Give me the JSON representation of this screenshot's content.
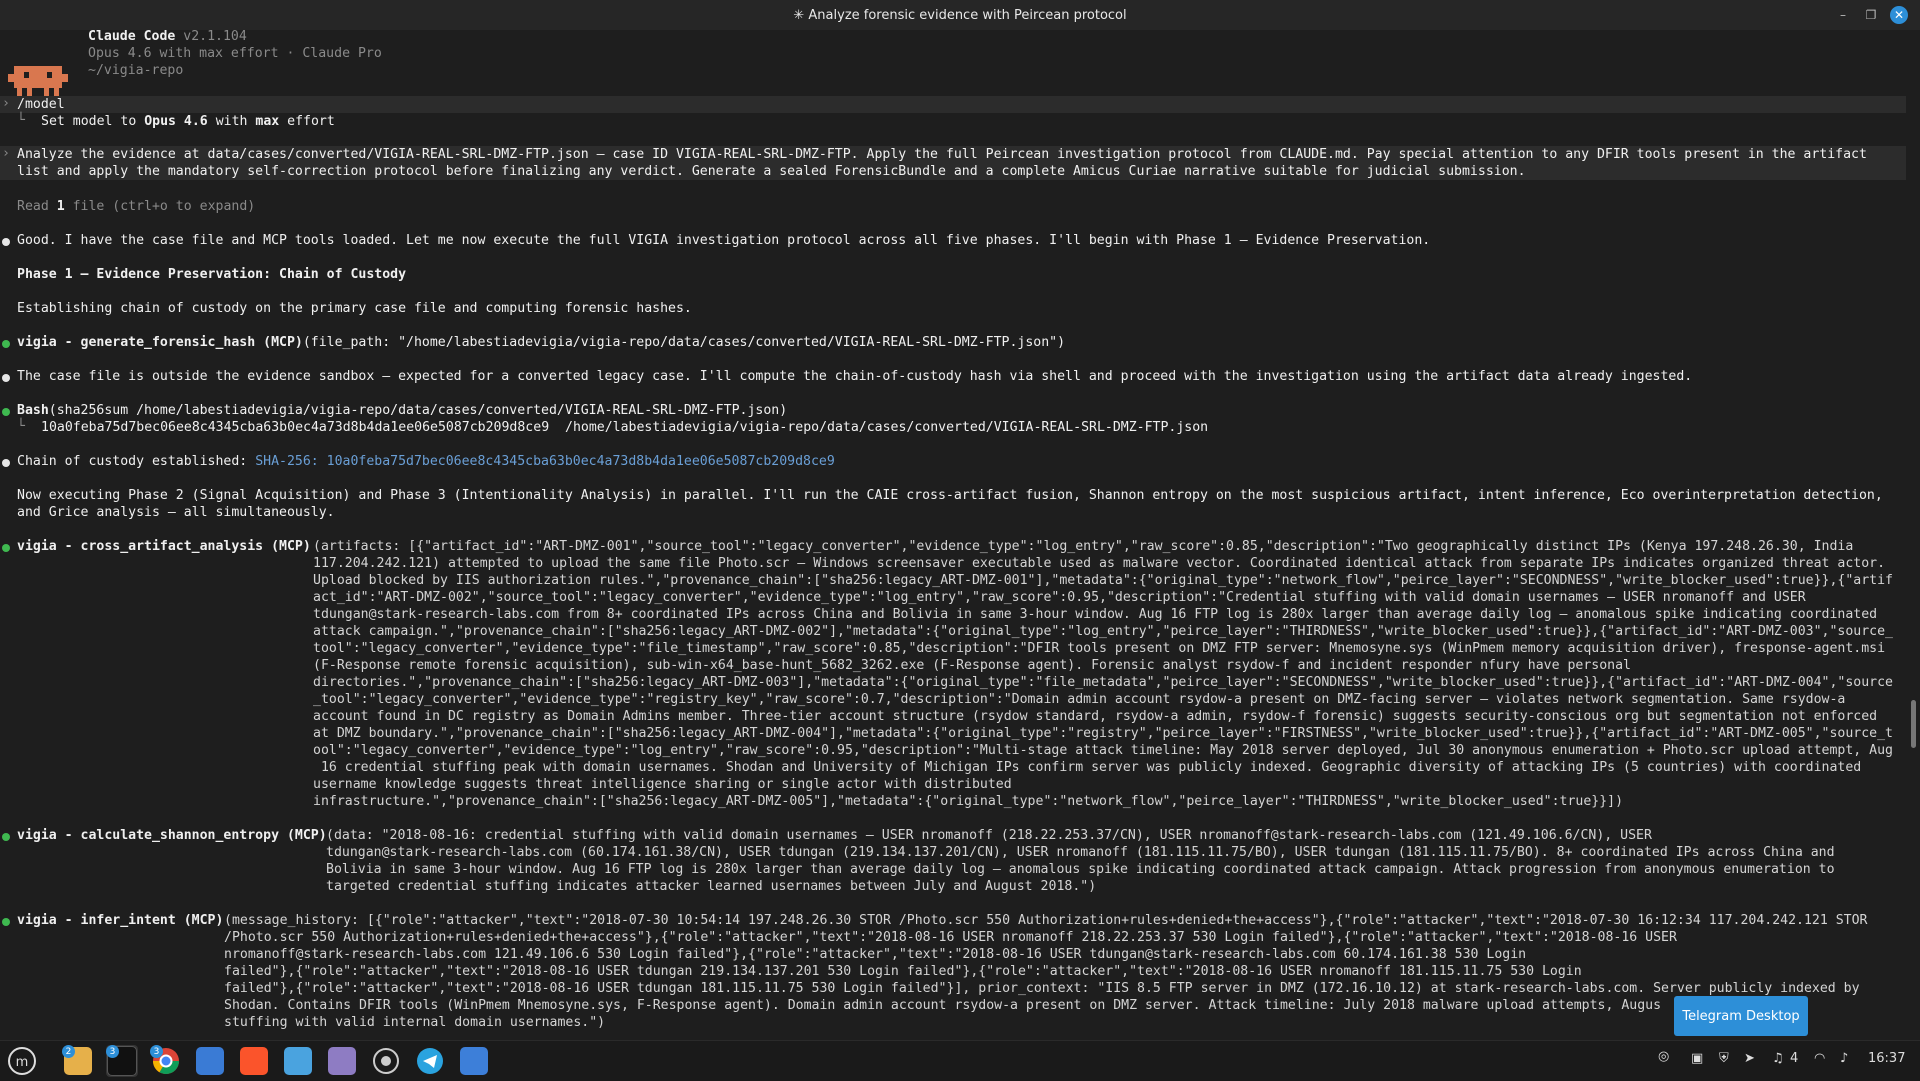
{
  "window": {
    "title": "✳ Analyze forensic evidence with Peircean protocol"
  },
  "header": {
    "app_name": "Claude Code",
    "version": "v2.1.104",
    "model_line": "Opus 4.6 with max effort · Claude Pro",
    "cwd": "~/vigia-repo"
  },
  "model_cmd": {
    "command": "/model",
    "result_prefix": "Set model to ",
    "result_model": "Opus 4.6",
    "result_mid": " with ",
    "result_effort": "max",
    "result_suffix": " effort"
  },
  "user_prompt": {
    "line1": "Analyze the evidence at data/cases/converted/VIGIA-REAL-SRL-DMZ-FTP.json — case ID VIGIA-REAL-SRL-DMZ-FTP. Apply the full Peircean investigation protocol from CLAUDE.md. Pay special attention to any DFIR tools present in the artifact",
    "line2": "list and apply the mandatory self-correction protocol before finalizing any verdict. Generate a sealed ForensicBundle and a complete Amicus Curiae narrative suitable for judicial submission."
  },
  "read_file": {
    "prefix": "Read ",
    "count": "1",
    "suffix": " file (ctrl+o to expand)"
  },
  "msg1": "Good. I have the case file and MCP tools loaded. Let me now execute the full VIGIA investigation protocol across all five phases. I'll begin with Phase 1 — Evidence Preservation.",
  "phase1_heading": "Phase 1 — Evidence Preservation: Chain of Custody",
  "msg2": "Establishing chain of custody on the primary case file and computing forensic hashes.",
  "tool1": {
    "name": "vigia - generate_forensic_hash (MCP)",
    "args": "(file_path: \"/home/labestiadevigia/vigia-repo/data/cases/converted/VIGIA-REAL-SRL-DMZ-FTP.json\")"
  },
  "msg3": "The case file is outside the evidence sandbox — expected for a converted legacy case. I'll compute the chain-of-custody hash via shell and proceed with the investigation using the artifact data already ingested.",
  "bash": {
    "name": "Bash",
    "args": "(sha256sum /home/labestiadevigia/vigia-repo/data/cases/converted/VIGIA-REAL-SRL-DMZ-FTP.json)",
    "output": "10a0feba75d7bec06ee8c4345cba63b0ec4a73d8b4da1ee06e5087cb209d8ce9  /home/labestiadevigia/vigia-repo/data/cases/converted/VIGIA-REAL-SRL-DMZ-FTP.json"
  },
  "custody": {
    "prefix": "Chain of custody established: ",
    "hash": "SHA-256: 10a0feba75d7bec06ee8c4345cba63b0ec4a73d8b4da1ee06e5087cb209d8ce9"
  },
  "msg4": {
    "line1": "Now executing Phase 2 (Signal Acquisition) and Phase 3 (Intentionality Analysis) in parallel. I'll run the CAIE cross-artifact fusion, Shannon entropy on the most suspicious artifact, intent inference, Eco overinterpretation detection,",
    "line2": "and Grice analysis — all simultaneously."
  },
  "tool2": {
    "name": "vigia - cross_artifact_analysis (MCP)",
    "lines": [
      "(artifacts: [{\"artifact_id\":\"ART-DMZ-001\",\"source_tool\":\"legacy_converter\",\"evidence_type\":\"log_entry\",\"raw_score\":0.85,\"description\":\"Two geographically distinct IPs (Kenya 197.248.26.30, India",
      "117.204.242.121) attempted to upload the same file Photo.scr — Windows screensaver executable used as malware vector. Coordinated identical attack from separate IPs indicates organized threat actor.",
      "Upload blocked by IIS authorization rules.\",\"provenance_chain\":[\"sha256:legacy_ART-DMZ-001\"],\"metadata\":{\"original_type\":\"network_flow\",\"peirce_layer\":\"SECONDNESS\",\"write_blocker_used\":true}},{\"artif",
      "act_id\":\"ART-DMZ-002\",\"source_tool\":\"legacy_converter\",\"evidence_type\":\"log_entry\",\"raw_score\":0.95,\"description\":\"Credential stuffing with valid domain usernames — USER nromanoff and USER",
      "tdungan@stark-research-labs.com from 8+ coordinated IPs across China and Bolivia in same 3-hour window. Aug 16 FTP log is 280x larger than average daily log — anomalous spike indicating coordinated",
      "attack campaign.\",\"provenance_chain\":[\"sha256:legacy_ART-DMZ-002\"],\"metadata\":{\"original_type\":\"log_entry\",\"peirce_layer\":\"THIRDNESS\",\"write_blocker_used\":true}},{\"artifact_id\":\"ART-DMZ-003\",\"source_",
      "tool\":\"legacy_converter\",\"evidence_type\":\"file_timestamp\",\"raw_score\":0.85,\"description\":\"DFIR tools present on DMZ FTP server: Mnemosyne.sys (WinPmem memory acquisition driver), fresponse-agent.msi",
      "(F-Response remote forensic acquisition), sub-win-x64_base-hunt_5682_3262.exe (F-Response agent). Forensic analyst rsydow-f and incident responder nfury have personal",
      "directories.\",\"provenance_chain\":[\"sha256:legacy_ART-DMZ-003\"],\"metadata\":{\"original_type\":\"file_metadata\",\"peirce_layer\":\"SECONDNESS\",\"write_blocker_used\":true}},{\"artifact_id\":\"ART-DMZ-004\",\"source",
      "_tool\":\"legacy_converter\",\"evidence_type\":\"registry_key\",\"raw_score\":0.7,\"description\":\"Domain admin account rsydow-a present on DMZ-facing server — violates network segmentation. Same rsydow-a",
      "account found in DC registry as Domain Admins member. Three-tier account structure (rsydow standard, rsydow-a admin, rsydow-f forensic) suggests security-conscious org but segmentation not enforced",
      "at DMZ boundary.\",\"provenance_chain\":[\"sha256:legacy_ART-DMZ-004\"],\"metadata\":{\"original_type\":\"registry\",\"peirce_layer\":\"FIRSTNESS\",\"write_blocker_used\":true}},{\"artifact_id\":\"ART-DMZ-005\",\"source_t",
      "ool\":\"legacy_converter\",\"evidence_type\":\"log_entry\",\"raw_score\":0.95,\"description\":\"Multi-stage attack timeline: May 2018 server deployed, Jul 30 anonymous enumeration + Photo.scr upload attempt, Aug",
      " 16 credential stuffing peak with domain usernames. Shodan and University of Michigan IPs confirm server was publicly indexed. Geographic diversity of attacking IPs (5 countries) with coordinated",
      "username knowledge suggests threat intelligence sharing or single actor with distributed",
      "infrastructure.\",\"provenance_chain\":[\"sha256:legacy_ART-DMZ-005\"],\"metadata\":{\"original_type\":\"network_flow\",\"peirce_layer\":\"THIRDNESS\",\"write_blocker_used\":true}}])"
    ]
  },
  "tool3": {
    "name": "vigia - calculate_shannon_entropy (MCP)",
    "lines": [
      "(data: \"2018-08-16: credential stuffing with valid domain usernames — USER nromanoff (218.22.253.37/CN), USER nromanoff@stark-research-labs.com (121.49.106.6/CN), USER",
      "tdungan@stark-research-labs.com (60.174.161.38/CN), USER tdungan (219.134.137.201/CN), USER nromanoff (181.115.11.75/BO), USER tdungan (181.115.11.75/BO). 8+ coordinated IPs across China and",
      "Bolivia in same 3-hour window. Aug 16 FTP log is 280x larger than average daily log — anomalous spike indicating coordinated attack campaign. Attack progression from anonymous enumeration to",
      "targeted credential stuffing indicates attacker learned usernames between July and August 2018.\")"
    ]
  },
  "tool4": {
    "name": "vigia - infer_intent (MCP)",
    "lines": [
      "(message_history: [{\"role\":\"attacker\",\"text\":\"2018-07-30 10:54:14 197.248.26.30 STOR /Photo.scr 550 Authorization+rules+denied+the+access\"},{\"role\":\"attacker\",\"text\":\"2018-07-30 16:12:34 117.204.242.121 STOR",
      "/Photo.scr 550 Authorization+rules+denied+the+access\"},{\"role\":\"attacker\",\"text\":\"2018-08-16 USER nromanoff 218.22.253.37 530 Login failed\"},{\"role\":\"attacker\",\"text\":\"2018-08-16 USER",
      "nromanoff@stark-research-labs.com 121.49.106.6 530 Login failed\"},{\"role\":\"attacker\",\"text\":\"2018-08-16 USER tdungan@stark-research-labs.com 60.174.161.38 530 Login",
      "failed\"},{\"role\":\"attacker\",\"text\":\"2018-08-16 USER tdungan 219.134.137.201 530 Login failed\"},{\"role\":\"attacker\",\"text\":\"2018-08-16 USER nromanoff 181.115.11.75 530 Login",
      "failed\"},{\"role\":\"attacker\",\"text\":\"2018-08-16 USER tdungan 181.115.11.75 530 Login failed\"}], prior_context: \"IIS 8.5 FTP server in DMZ (172.16.10.12) at stark-research-labs.com. Server publicly indexed by",
      "Shodan. Contains DFIR tools (WinPmem Mnemosyne.sys, F-Response agent). Domain admin account rsydow-a present on DMZ server. Attack timeline: July 2018 malware upload attempts, Augus      d credential",
      "stuffing with valid internal domain usernames.\")"
    ]
  },
  "tooltip": "Telegram Desktop",
  "taskbar": {
    "apps": [
      {
        "name": "files",
        "badge": "2"
      },
      {
        "name": "terminal",
        "badge": "3"
      },
      {
        "name": "chrome",
        "badge": "3"
      },
      {
        "name": "screenshot"
      },
      {
        "name": "brave"
      },
      {
        "name": "monitor"
      },
      {
        "name": "notes"
      },
      {
        "name": "github"
      },
      {
        "name": "telegram"
      },
      {
        "name": "text-editor"
      }
    ],
    "notif_count": "4",
    "clock": "16:37"
  },
  "colors": {
    "background": "#1e1e1e",
    "green_bullet": "#3fb950",
    "hash_blue": "#6a9fd6",
    "accent": "#2d8fd8",
    "logo": "#d9774f"
  }
}
